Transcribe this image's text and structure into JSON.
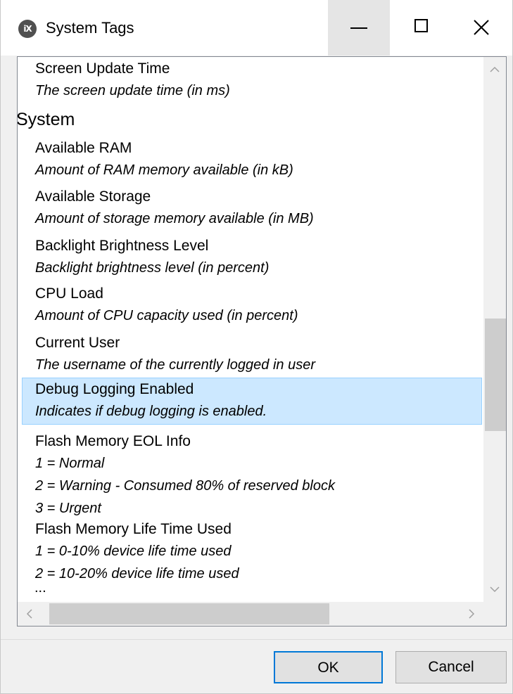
{
  "window": {
    "title": "System Tags",
    "app_icon_text": "iX"
  },
  "list": {
    "items_before_group": [
      {
        "name": "Screen Update Time",
        "description": [
          "The screen update time (in ms)"
        ]
      }
    ],
    "group_header": "System",
    "items": [
      {
        "name": "Available RAM",
        "description": [
          "Amount of RAM memory available (in kB)"
        ]
      },
      {
        "name": "Available Storage",
        "description": [
          "Amount of storage memory available (in MB)"
        ]
      },
      {
        "name": "Backlight Brightness Level",
        "description": [
          "Backlight brightness level (in percent)"
        ]
      },
      {
        "name": "CPU Load",
        "description": [
          "Amount of CPU capacity used (in percent)"
        ]
      },
      {
        "name": "Current User",
        "description": [
          "The username of the currently logged in user"
        ]
      },
      {
        "name": "Debug Logging Enabled",
        "description": [
          "Indicates if debug logging is enabled."
        ],
        "selected": true
      },
      {
        "name": "Flash Memory EOL Info",
        "description": [
          "1 = Normal",
          "2 = Warning - Consumed 80% of reserved block",
          "3 = Urgent"
        ]
      },
      {
        "name": "Flash Memory Life Time Used",
        "description": [
          "1 = 0-10% device life time used",
          "2 = 10-20% device life time used"
        ]
      }
    ],
    "truncation_text": "..."
  },
  "buttons": {
    "ok_label": "OK",
    "cancel_label": "Cancel"
  },
  "colors": {
    "selection_background": "#cce8ff",
    "selection_border": "#99d1ff",
    "default_button_border": "#0078d7"
  },
  "icons": {
    "minimize": "minimize-icon",
    "maximize": "maximize-icon",
    "close": "close-icon"
  }
}
